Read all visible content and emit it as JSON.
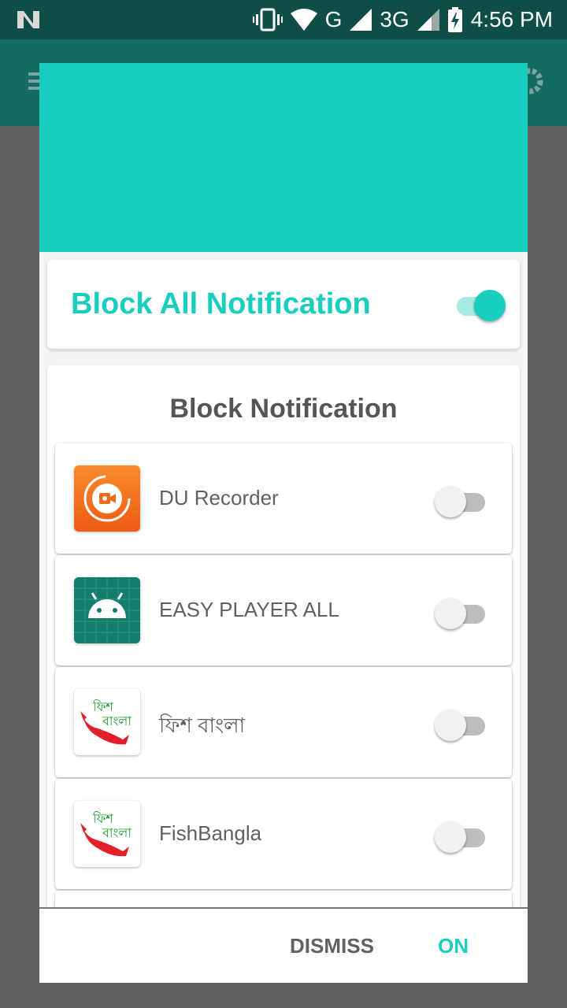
{
  "status_bar": {
    "time": "4:56 PM",
    "network_g": "G",
    "network_3g": "3G",
    "icons": [
      "notification-n-icon",
      "vibrate-icon",
      "wifi-icon",
      "signal-icon",
      "signal-icon",
      "battery-charging-icon"
    ]
  },
  "app_bar": {
    "icons": [
      "menu-icon",
      "gear-icon"
    ]
  },
  "dialog": {
    "header_color": "#17cebf",
    "master": {
      "title": "Block All Notification",
      "enabled": true
    },
    "list": {
      "title": "Block Notification",
      "apps": [
        {
          "name": "DU Recorder",
          "icon": "du-recorder-icon",
          "enabled": false
        },
        {
          "name": "EASY PLAYER ALL",
          "icon": "android-icon",
          "enabled": false
        },
        {
          "name": "ফিশ বাংলা",
          "icon": "fish-bangla-icon",
          "enabled": false
        },
        {
          "name": "FishBangla",
          "icon": "fish-bangla-icon",
          "enabled": false
        }
      ]
    },
    "buttons": {
      "dismiss": "DISMISS",
      "on": "ON"
    }
  },
  "colors": {
    "accent": "#17cebf",
    "status_bar": "#0f4e47",
    "app_bar": "#146b62"
  }
}
